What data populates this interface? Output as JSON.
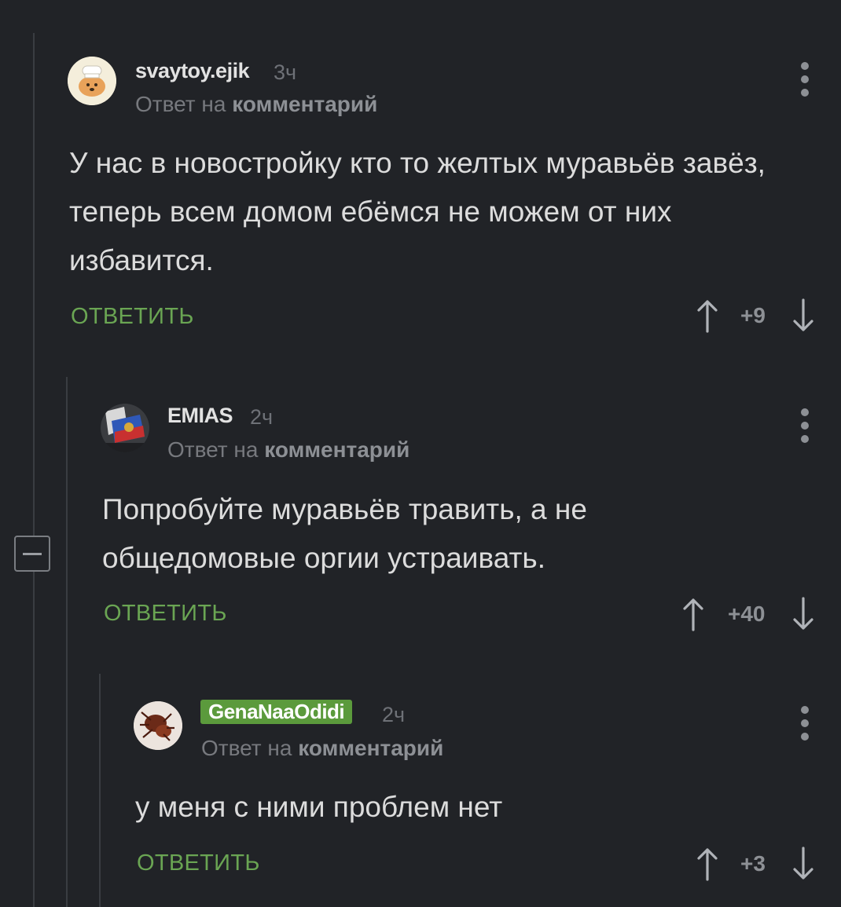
{
  "comments": [
    {
      "username": "svaytoy.ejik",
      "time": "3ч",
      "reply_prefix": "Ответ на",
      "reply_target": "комментарий",
      "text": "У нас в новостройку кто то желтых муравьёв завёз, теперь всем домом ебёмся не можем от них избавится.",
      "reply_label": "ОТВЕТИТЬ",
      "score": "+9"
    },
    {
      "username": "EMIAS",
      "time": "2ч",
      "reply_prefix": "Ответ на",
      "reply_target": "комментарий",
      "text": "Попробуйте муравьёв травить, а не общедомовые оргии устраивать.",
      "reply_label": "ОТВЕТИТЬ",
      "score": "+40"
    },
    {
      "username": "GenaNaaOdidi",
      "time": "2ч",
      "reply_prefix": "Ответ на",
      "reply_target": "комментарий",
      "text": "у меня с ними проблем нет",
      "reply_label": "ОТВЕТИТЬ",
      "score": "+3"
    }
  ],
  "icons": {
    "upvote": "arrow-up-icon",
    "downvote": "arrow-down-icon",
    "menu": "more-vertical-icon",
    "collapse": "minus-box-icon"
  },
  "colors": {
    "background": "#212327",
    "accent": "#6aa553",
    "badge": "#5b9a3c"
  }
}
